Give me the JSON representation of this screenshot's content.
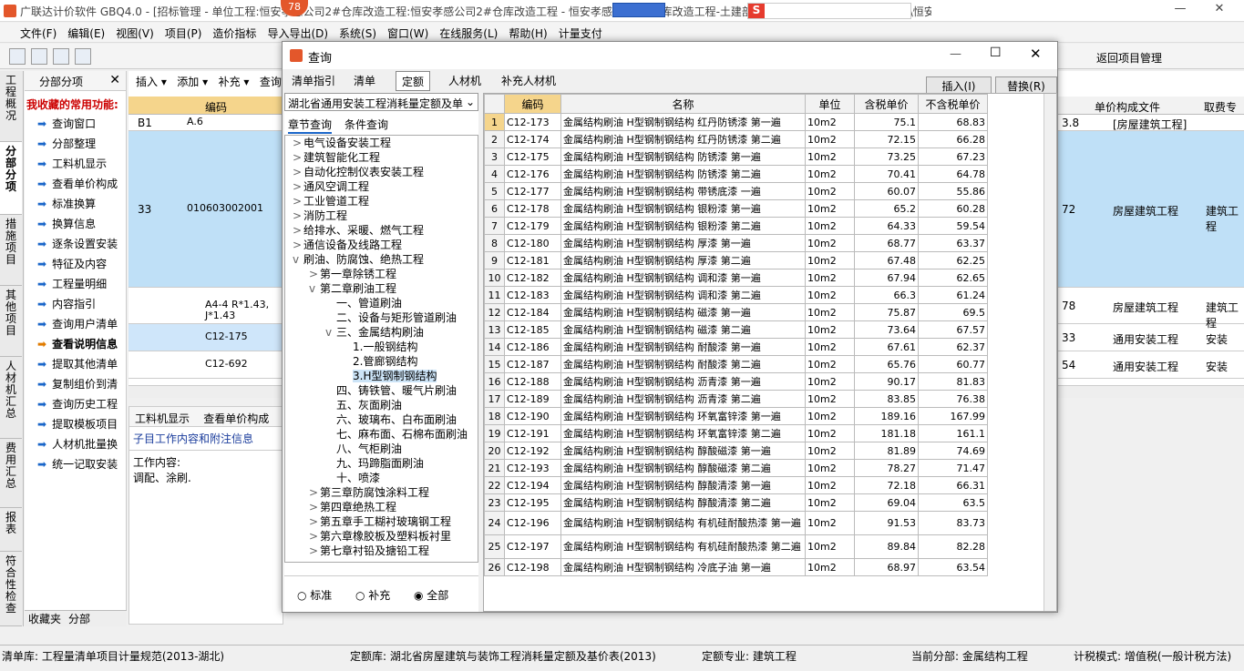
{
  "app": {
    "title": "广联达计价软件 GBQ4.0 - [招标管理 - 单位工程:恒安孝感公司2#仓库改造工程:恒安孝感公司2#仓库改造工程 - 恒安孝感公司2#仓库改造工程-土建部分] 20141127NRHM\\Desktop\\恒安孝感公...",
    "badge": "78"
  },
  "menu": [
    "文件(F)",
    "编辑(E)",
    "视图(V)",
    "项目(P)",
    "造价指标",
    "导入导出(D)",
    "系统(S)",
    "窗口(W)",
    "在线服务(L)",
    "帮助(H)",
    "计量支付"
  ],
  "toolbar": {
    "insert": "插入",
    "add": "添加",
    "supplement": "补充",
    "query": "查询",
    "return_project": "返回项目管理"
  },
  "left_tabs": [
    "工程概况",
    "分部分项",
    "措施项目",
    "其他项目",
    "人材机汇总",
    "费用汇总",
    "报表",
    "符合性检查"
  ],
  "left_panel": {
    "header": "分部分项",
    "fav_title": "我收藏的常用功能:",
    "items": [
      "查询窗口",
      "分部整理",
      "工料机显示",
      "查看单价构成",
      "标准换算",
      "换算信息",
      "逐条设置安装",
      "特征及内容",
      "工程量明细",
      "内容指引",
      "查询用户清单",
      "查看说明信息",
      "提取其他清单",
      "复制组价到清",
      "查询历史工程",
      "提取模板项目",
      "人材机批量换",
      "统一记取安装"
    ],
    "bottom_tabs": [
      "收藏夹",
      "分部"
    ]
  },
  "bg_table": {
    "col_code": "编码",
    "col_unit_file": "单价构成文件",
    "col_fee": "取费专",
    "rows": [
      {
        "no": "B1",
        "code": "A.6",
        "val": "3.8",
        "file": "[房屋建筑工程]",
        "fee": ""
      },
      {
        "no": "33",
        "code": "010603002001",
        "val": "72",
        "file": "房屋建筑工程",
        "fee": "建筑工程"
      },
      {
        "no": "",
        "code": "A4-4 R*1.43, J*1.43",
        "val": "78",
        "file": "房屋建筑工程",
        "fee": "建筑工程"
      },
      {
        "no": "",
        "code": "C12-175",
        "val": "33",
        "file": "通用安装工程",
        "fee": "安装"
      },
      {
        "no": "",
        "code": "C12-692",
        "val": "54",
        "file": "通用安装工程",
        "fee": "安装"
      }
    ]
  },
  "bottom_panel": {
    "tab1": "工料机显示",
    "tab2": "查看单价构成",
    "title": "子目工作内容和附注信息",
    "content": "工作内容:\n调配、涂刷."
  },
  "dialog": {
    "title": "查询",
    "tabs": [
      "清单指引",
      "清单",
      "定额",
      "人材机",
      "补充人材机"
    ],
    "active_tab": "定额",
    "insert_btn": "插入(I)",
    "replace_btn": "替换(R)",
    "library": "湖北省通用安装工程消耗量定额及单",
    "sub_tabs": [
      "章节查询",
      "条件查询"
    ],
    "tree": [
      {
        "level": 0,
        "exp": ">",
        "text": "电气设备安装工程"
      },
      {
        "level": 0,
        "exp": ">",
        "text": "建筑智能化工程"
      },
      {
        "level": 0,
        "exp": ">",
        "text": "自动化控制仪表安装工程"
      },
      {
        "level": 0,
        "exp": ">",
        "text": "通风空调工程"
      },
      {
        "level": 0,
        "exp": ">",
        "text": "工业管道工程"
      },
      {
        "level": 0,
        "exp": ">",
        "text": "消防工程"
      },
      {
        "level": 0,
        "exp": ">",
        "text": "给排水、采暖、燃气工程"
      },
      {
        "level": 0,
        "exp": ">",
        "text": "通信设备及线路工程"
      },
      {
        "level": 0,
        "exp": "v",
        "text": "刷油、防腐蚀、绝热工程"
      },
      {
        "level": 1,
        "exp": ">",
        "text": "第一章除锈工程"
      },
      {
        "level": 1,
        "exp": "v",
        "text": "第二章刷油工程"
      },
      {
        "level": 2,
        "exp": "",
        "text": "一、管道刷油"
      },
      {
        "level": 2,
        "exp": "",
        "text": "二、设备与矩形管道刷油"
      },
      {
        "level": 2,
        "exp": "v",
        "text": "三、金属结构刷油"
      },
      {
        "level": 3,
        "exp": "",
        "text": "1.一般钢结构"
      },
      {
        "level": 3,
        "exp": "",
        "text": "2.管廊钢结构"
      },
      {
        "level": 3,
        "exp": "",
        "text": "3.H型钢制钢结构",
        "sel": true
      },
      {
        "level": 2,
        "exp": "",
        "text": "四、铸铁管、暖气片刷油"
      },
      {
        "level": 2,
        "exp": "",
        "text": "五、灰面刷油"
      },
      {
        "level": 2,
        "exp": "",
        "text": "六、玻璃布、白布面刷油"
      },
      {
        "level": 2,
        "exp": "",
        "text": "七、麻布面、石棉布面刷油"
      },
      {
        "level": 2,
        "exp": "",
        "text": "八、气柜刷油"
      },
      {
        "level": 2,
        "exp": "",
        "text": "九、玛蹄脂面刷油"
      },
      {
        "level": 2,
        "exp": "",
        "text": "十、喷漆"
      },
      {
        "level": 1,
        "exp": ">",
        "text": "第三章防腐蚀涂料工程"
      },
      {
        "level": 1,
        "exp": ">",
        "text": "第四章绝热工程"
      },
      {
        "level": 1,
        "exp": ">",
        "text": "第五章手工糊衬玻璃钢工程"
      },
      {
        "level": 1,
        "exp": ">",
        "text": "第六章橡胶板及塑料板衬里"
      },
      {
        "level": 1,
        "exp": ">",
        "text": "第七章衬铅及搪铅工程"
      }
    ],
    "radios": [
      "标准",
      "补充",
      "全部"
    ],
    "radio_selected": "全部",
    "headers": [
      "编码",
      "名称",
      "单位",
      "含税单价",
      "不含税单价"
    ],
    "rows": [
      [
        "1",
        "C12-173",
        "金属结构刷油 H型钢制钢结构 红丹防锈漆 第一遍",
        "10m2",
        "75.1",
        "68.83"
      ],
      [
        "2",
        "C12-174",
        "金属结构刷油 H型钢制钢结构 红丹防锈漆 第二遍",
        "10m2",
        "72.15",
        "66.28"
      ],
      [
        "3",
        "C12-175",
        "金属结构刷油 H型钢制钢结构 防锈漆 第一遍",
        "10m2",
        "73.25",
        "67.23"
      ],
      [
        "4",
        "C12-176",
        "金属结构刷油 H型钢制钢结构 防锈漆 第二遍",
        "10m2",
        "70.41",
        "64.78"
      ],
      [
        "5",
        "C12-177",
        "金属结构刷油 H型钢制钢结构 带锈底漆 一遍",
        "10m2",
        "60.07",
        "55.86"
      ],
      [
        "6",
        "C12-178",
        "金属结构刷油 H型钢制钢结构 银粉漆 第一遍",
        "10m2",
        "65.2",
        "60.28"
      ],
      [
        "7",
        "C12-179",
        "金属结构刷油 H型钢制钢结构 银粉漆 第二遍",
        "10m2",
        "64.33",
        "59.54"
      ],
      [
        "8",
        "C12-180",
        "金属结构刷油 H型钢制钢结构 厚漆 第一遍",
        "10m2",
        "68.77",
        "63.37"
      ],
      [
        "9",
        "C12-181",
        "金属结构刷油 H型钢制钢结构 厚漆 第二遍",
        "10m2",
        "67.48",
        "62.25"
      ],
      [
        "10",
        "C12-182",
        "金属结构刷油 H型钢制钢结构 调和漆 第一遍",
        "10m2",
        "67.94",
        "62.65"
      ],
      [
        "11",
        "C12-183",
        "金属结构刷油 H型钢制钢结构 调和漆 第二遍",
        "10m2",
        "66.3",
        "61.24"
      ],
      [
        "12",
        "C12-184",
        "金属结构刷油 H型钢制钢结构 磁漆 第一遍",
        "10m2",
        "75.87",
        "69.5"
      ],
      [
        "13",
        "C12-185",
        "金属结构刷油 H型钢制钢结构 磁漆 第二遍",
        "10m2",
        "73.64",
        "67.57"
      ],
      [
        "14",
        "C12-186",
        "金属结构刷油 H型钢制钢结构 耐酸漆 第一遍",
        "10m2",
        "67.61",
        "62.37"
      ],
      [
        "15",
        "C12-187",
        "金属结构刷油 H型钢制钢结构 耐酸漆 第二遍",
        "10m2",
        "65.76",
        "60.77"
      ],
      [
        "16",
        "C12-188",
        "金属结构刷油 H型钢制钢结构 沥青漆 第一遍",
        "10m2",
        "90.17",
        "81.83"
      ],
      [
        "17",
        "C12-189",
        "金属结构刷油 H型钢制钢结构 沥青漆 第二遍",
        "10m2",
        "83.85",
        "76.38"
      ],
      [
        "18",
        "C12-190",
        "金属结构刷油 H型钢制钢结构 环氧富锌漆 第一遍",
        "10m2",
        "189.16",
        "167.99"
      ],
      [
        "19",
        "C12-191",
        "金属结构刷油 H型钢制钢结构 环氧富锌漆 第二遍",
        "10m2",
        "181.18",
        "161.1"
      ],
      [
        "20",
        "C12-192",
        "金属结构刷油 H型钢制钢结构 醇酸磁漆 第一遍",
        "10m2",
        "81.89",
        "74.69"
      ],
      [
        "21",
        "C12-193",
        "金属结构刷油 H型钢制钢结构 醇酸磁漆 第二遍",
        "10m2",
        "78.27",
        "71.47"
      ],
      [
        "22",
        "C12-194",
        "金属结构刷油 H型钢制钢结构 醇酸清漆 第一遍",
        "10m2",
        "72.18",
        "66.31"
      ],
      [
        "23",
        "C12-195",
        "金属结构刷油 H型钢制钢结构 醇酸清漆 第二遍",
        "10m2",
        "69.04",
        "63.5"
      ],
      [
        "24",
        "C12-196",
        "金属结构刷油 H型钢制钢结构 有机硅耐酸热漆 第一遍",
        "10m2",
        "91.53",
        "83.73"
      ],
      [
        "25",
        "C12-197",
        "金属结构刷油 H型钢制钢结构 有机硅耐酸热漆 第二遍",
        "10m2",
        "89.84",
        "82.28"
      ],
      [
        "26",
        "C12-198",
        "金属结构刷油 H型钢制钢结构 冷底子油 第一遍",
        "10m2",
        "68.97",
        "63.54"
      ]
    ]
  },
  "status": {
    "s1": "清单库: 工程量清单项目计量规范(2013-湖北)",
    "s2": "定额库: 湖北省房屋建筑与装饰工程消耗量定额及基价表(2013)",
    "s3": "定额专业: 建筑工程",
    "s4": "当前分部: 金属结构工程",
    "s5": "计税模式: 增值税(一般计税方法)"
  }
}
